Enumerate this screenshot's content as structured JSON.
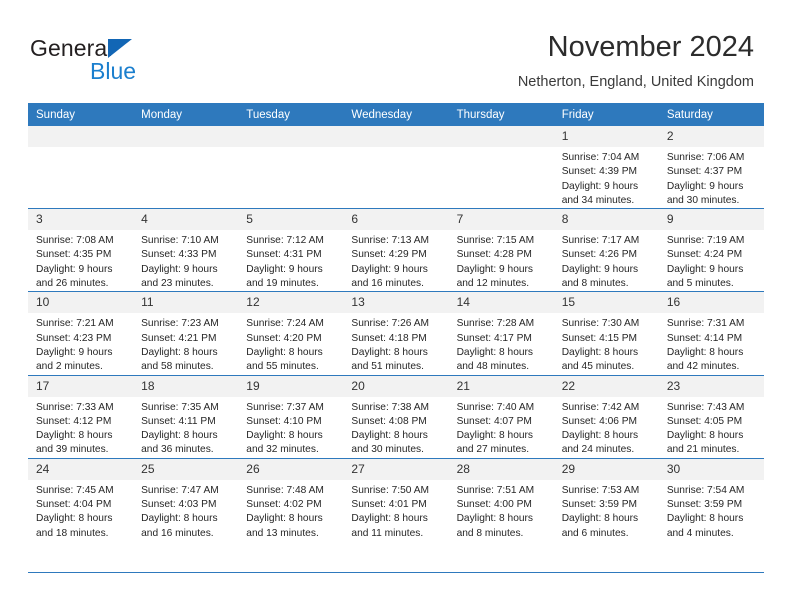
{
  "brand": {
    "name_top": "General",
    "name_bottom": "Blue",
    "triangle_color": "#1266b5",
    "blue_text_color": "#1b7fce"
  },
  "header": {
    "title": "November 2024",
    "subtitle": "Netherton, England, United Kingdom"
  },
  "theme": {
    "header_blue": "#2e79bd",
    "daynum_band": "#f2f2f2",
    "text": "#262626"
  },
  "weekday_headers": [
    "Sunday",
    "Monday",
    "Tuesday",
    "Wednesday",
    "Thursday",
    "Friday",
    "Saturday"
  ],
  "weeks": [
    [
      {
        "day": "",
        "lines": []
      },
      {
        "day": "",
        "lines": []
      },
      {
        "day": "",
        "lines": []
      },
      {
        "day": "",
        "lines": []
      },
      {
        "day": "",
        "lines": []
      },
      {
        "day": "1",
        "lines": [
          "Sunrise: 7:04 AM",
          "Sunset: 4:39 PM",
          "Daylight: 9 hours",
          "and 34 minutes."
        ]
      },
      {
        "day": "2",
        "lines": [
          "Sunrise: 7:06 AM",
          "Sunset: 4:37 PM",
          "Daylight: 9 hours",
          "and 30 minutes."
        ]
      }
    ],
    [
      {
        "day": "3",
        "lines": [
          "Sunrise: 7:08 AM",
          "Sunset: 4:35 PM",
          "Daylight: 9 hours",
          "and 26 minutes."
        ]
      },
      {
        "day": "4",
        "lines": [
          "Sunrise: 7:10 AM",
          "Sunset: 4:33 PM",
          "Daylight: 9 hours",
          "and 23 minutes."
        ]
      },
      {
        "day": "5",
        "lines": [
          "Sunrise: 7:12 AM",
          "Sunset: 4:31 PM",
          "Daylight: 9 hours",
          "and 19 minutes."
        ]
      },
      {
        "day": "6",
        "lines": [
          "Sunrise: 7:13 AM",
          "Sunset: 4:29 PM",
          "Daylight: 9 hours",
          "and 16 minutes."
        ]
      },
      {
        "day": "7",
        "lines": [
          "Sunrise: 7:15 AM",
          "Sunset: 4:28 PM",
          "Daylight: 9 hours",
          "and 12 minutes."
        ]
      },
      {
        "day": "8",
        "lines": [
          "Sunrise: 7:17 AM",
          "Sunset: 4:26 PM",
          "Daylight: 9 hours",
          "and 8 minutes."
        ]
      },
      {
        "day": "9",
        "lines": [
          "Sunrise: 7:19 AM",
          "Sunset: 4:24 PM",
          "Daylight: 9 hours",
          "and 5 minutes."
        ]
      }
    ],
    [
      {
        "day": "10",
        "lines": [
          "Sunrise: 7:21 AM",
          "Sunset: 4:23 PM",
          "Daylight: 9 hours",
          "and 2 minutes."
        ]
      },
      {
        "day": "11",
        "lines": [
          "Sunrise: 7:23 AM",
          "Sunset: 4:21 PM",
          "Daylight: 8 hours",
          "and 58 minutes."
        ]
      },
      {
        "day": "12",
        "lines": [
          "Sunrise: 7:24 AM",
          "Sunset: 4:20 PM",
          "Daylight: 8 hours",
          "and 55 minutes."
        ]
      },
      {
        "day": "13",
        "lines": [
          "Sunrise: 7:26 AM",
          "Sunset: 4:18 PM",
          "Daylight: 8 hours",
          "and 51 minutes."
        ]
      },
      {
        "day": "14",
        "lines": [
          "Sunrise: 7:28 AM",
          "Sunset: 4:17 PM",
          "Daylight: 8 hours",
          "and 48 minutes."
        ]
      },
      {
        "day": "15",
        "lines": [
          "Sunrise: 7:30 AM",
          "Sunset: 4:15 PM",
          "Daylight: 8 hours",
          "and 45 minutes."
        ]
      },
      {
        "day": "16",
        "lines": [
          "Sunrise: 7:31 AM",
          "Sunset: 4:14 PM",
          "Daylight: 8 hours",
          "and 42 minutes."
        ]
      }
    ],
    [
      {
        "day": "17",
        "lines": [
          "Sunrise: 7:33 AM",
          "Sunset: 4:12 PM",
          "Daylight: 8 hours",
          "and 39 minutes."
        ]
      },
      {
        "day": "18",
        "lines": [
          "Sunrise: 7:35 AM",
          "Sunset: 4:11 PM",
          "Daylight: 8 hours",
          "and 36 minutes."
        ]
      },
      {
        "day": "19",
        "lines": [
          "Sunrise: 7:37 AM",
          "Sunset: 4:10 PM",
          "Daylight: 8 hours",
          "and 32 minutes."
        ]
      },
      {
        "day": "20",
        "lines": [
          "Sunrise: 7:38 AM",
          "Sunset: 4:08 PM",
          "Daylight: 8 hours",
          "and 30 minutes."
        ]
      },
      {
        "day": "21",
        "lines": [
          "Sunrise: 7:40 AM",
          "Sunset: 4:07 PM",
          "Daylight: 8 hours",
          "and 27 minutes."
        ]
      },
      {
        "day": "22",
        "lines": [
          "Sunrise: 7:42 AM",
          "Sunset: 4:06 PM",
          "Daylight: 8 hours",
          "and 24 minutes."
        ]
      },
      {
        "day": "23",
        "lines": [
          "Sunrise: 7:43 AM",
          "Sunset: 4:05 PM",
          "Daylight: 8 hours",
          "and 21 minutes."
        ]
      }
    ],
    [
      {
        "day": "24",
        "lines": [
          "Sunrise: 7:45 AM",
          "Sunset: 4:04 PM",
          "Daylight: 8 hours",
          "and 18 minutes."
        ]
      },
      {
        "day": "25",
        "lines": [
          "Sunrise: 7:47 AM",
          "Sunset: 4:03 PM",
          "Daylight: 8 hours",
          "and 16 minutes."
        ]
      },
      {
        "day": "26",
        "lines": [
          "Sunrise: 7:48 AM",
          "Sunset: 4:02 PM",
          "Daylight: 8 hours",
          "and 13 minutes."
        ]
      },
      {
        "day": "27",
        "lines": [
          "Sunrise: 7:50 AM",
          "Sunset: 4:01 PM",
          "Daylight: 8 hours",
          "and 11 minutes."
        ]
      },
      {
        "day": "28",
        "lines": [
          "Sunrise: 7:51 AM",
          "Sunset: 4:00 PM",
          "Daylight: 8 hours",
          "and 8 minutes."
        ]
      },
      {
        "day": "29",
        "lines": [
          "Sunrise: 7:53 AM",
          "Sunset: 3:59 PM",
          "Daylight: 8 hours",
          "and 6 minutes."
        ]
      },
      {
        "day": "30",
        "lines": [
          "Sunrise: 7:54 AM",
          "Sunset: 3:59 PM",
          "Daylight: 8 hours",
          "and 4 minutes."
        ]
      }
    ]
  ]
}
